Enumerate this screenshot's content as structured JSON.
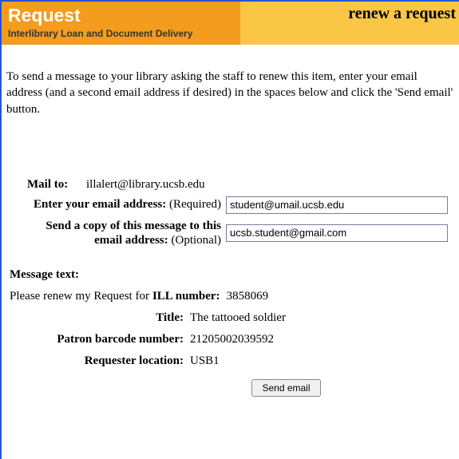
{
  "header": {
    "title": "Request",
    "subtitle": "Interlibrary Loan and Document Delivery",
    "action": "renew a request"
  },
  "intro": "To send a message to your library asking the staff to renew this item, enter your email address (and a second email address if desired) in the spaces below and click the 'Send email' button.",
  "form": {
    "mailto_label": "Mail to:",
    "mailto_value": "illalert@library.ucsb.edu",
    "email_label_bold": "Enter your email address:",
    "email_label_note": "(Required)",
    "email_value": "student@umail.ucsb.edu",
    "cc_label_bold_line1": "Send a copy of this message to this",
    "cc_label_bold_line2": "email address:",
    "cc_label_note": "(Optional)",
    "cc_value": "ucsb.student@gmail.com"
  },
  "message": {
    "heading": "Message text:",
    "please_prefix": "Please renew my Request for",
    "ill_label": "ILL number:",
    "ill_value": "3858069",
    "title_label": "Title:",
    "title_value": "The tattooed soldier",
    "barcode_label": "Patron barcode number:",
    "barcode_value": "21205002039592",
    "location_label": "Requester location:",
    "location_value": "USB1"
  },
  "buttons": {
    "send": "Send email"
  }
}
